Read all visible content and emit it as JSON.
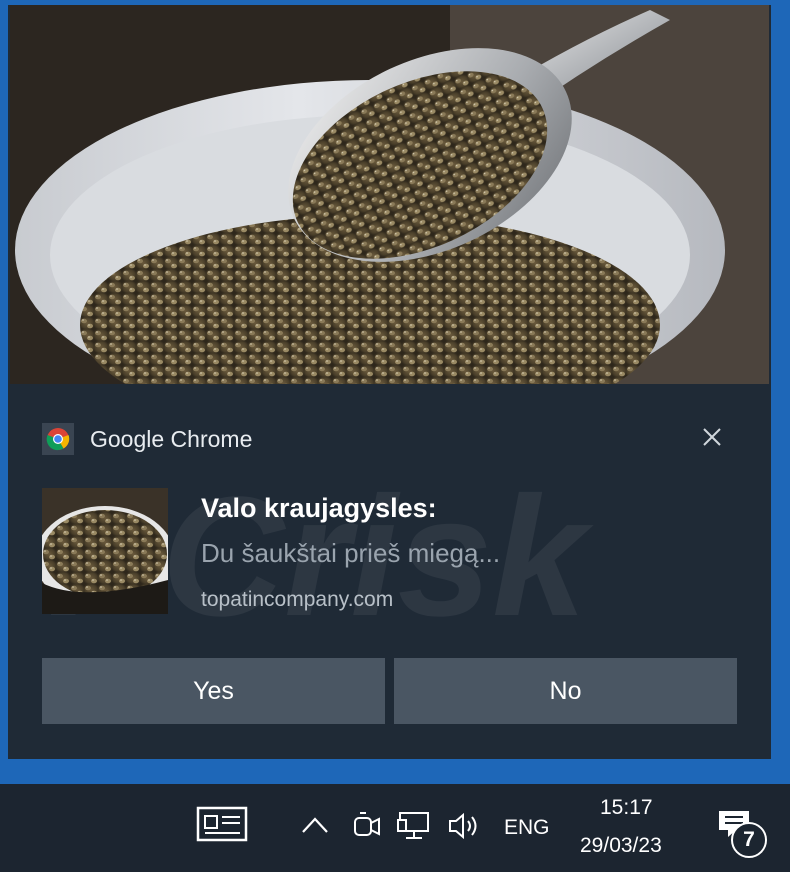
{
  "notification": {
    "app_name": "Google Chrome",
    "title": "Valo kraujagysles:",
    "body": "Du šaukštai prieš miegą...",
    "source": "topatincompany.com",
    "actions": [
      {
        "label": "Yes"
      },
      {
        "label": "No"
      }
    ]
  },
  "taskbar": {
    "language": "ENG",
    "time": "15:17",
    "date": "29/03/23",
    "notification_count": "7",
    "icons": [
      "news-widget-icon",
      "chevron-up-icon",
      "meet-now-icon",
      "network-icon",
      "volume-icon",
      "action-center-icon"
    ]
  },
  "colors": {
    "desktop_accent": "#1e67b8",
    "toast_background": "#1f2a36",
    "button_background": "#4a5663",
    "taskbar_background": "#1c2530"
  }
}
